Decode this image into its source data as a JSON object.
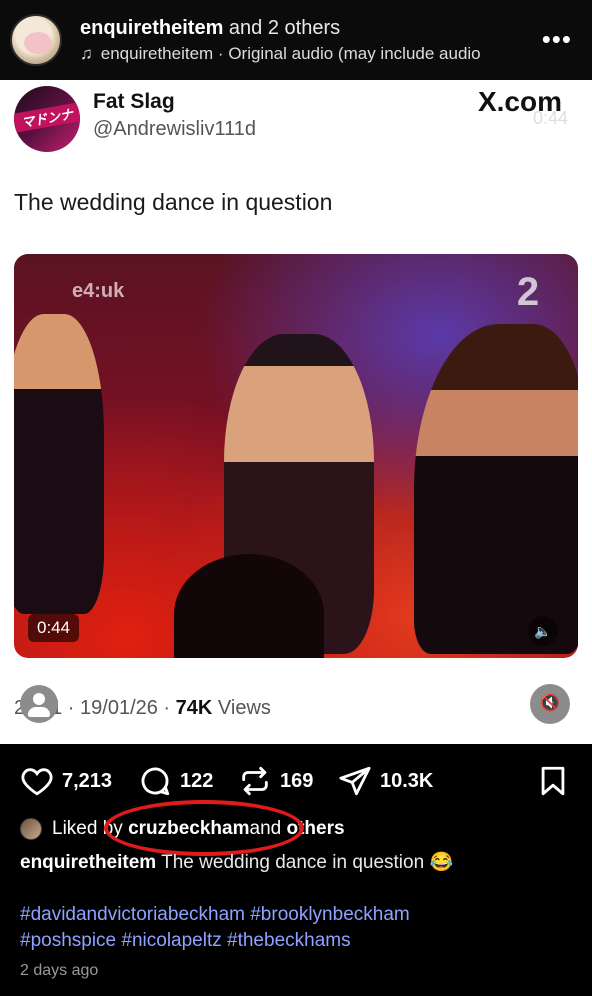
{
  "header": {
    "account": "enquiretheitem",
    "others": " and 2 others",
    "audio": "enquiretheitem · Original audio  (may include audio",
    "icons": [
      "music-note-icon",
      "more-icon"
    ]
  },
  "tweet": {
    "name": "Fat Slag",
    "handle": "@Andrewisliv111d",
    "brand": "X.com",
    "brand_overlay": "0:44",
    "text": "The wedding dance in question",
    "video": {
      "channel_logo": "e4:uk",
      "channel_badge": "2",
      "duration": "0:44"
    },
    "meta_prefix": "2",
    "meta_mid": "1 · 19/01/26 · ",
    "views_count": "74K",
    "views_label": " Views",
    "avatar_text": "マドンナ"
  },
  "actions": {
    "likes": "7,213",
    "comments": "122",
    "reposts": "169",
    "shares": "10.3K"
  },
  "liked": {
    "prefix": "Liked by ",
    "user": "cruzbeckham",
    "suffix": " and ",
    "others": "others"
  },
  "caption": {
    "user": "enquiretheitem",
    "text": " The wedding dance in question 😂"
  },
  "hashtags": {
    "line1": "#davidandvictoriabeckham #brooklynbeckham",
    "line2": "#poshspice #nicolapeltz #thebeckhams"
  },
  "time_ago": "2 days ago",
  "colors": {
    "annotation": "#e01b1b",
    "hashtag": "#8ea2ff"
  }
}
